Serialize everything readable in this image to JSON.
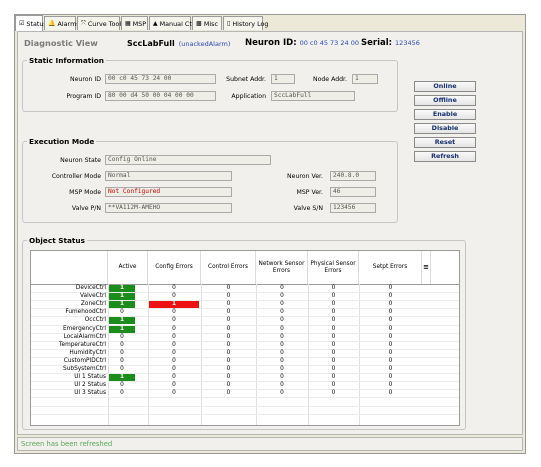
{
  "tabs": [
    {
      "label": "Status",
      "icon": "status-icon",
      "glyph": "☑"
    },
    {
      "label": "Alarms",
      "icon": "bell-icon",
      "glyph": "🔔"
    },
    {
      "label": "Curve Tool",
      "icon": "curve-tool-icon",
      "glyph": "⤧"
    },
    {
      "label": "MSP",
      "icon": "msp-icon",
      "glyph": "▦"
    },
    {
      "label": "Manual Ctrl",
      "icon": "manual-ctrl-icon",
      "glyph": "▲"
    },
    {
      "label": "Misc",
      "icon": "misc-icon",
      "glyph": "▩"
    },
    {
      "label": "History Log",
      "icon": "history-log-icon",
      "glyph": "▯"
    }
  ],
  "header": {
    "title": "Diagnostic View",
    "device": "SccLabFull",
    "alarm": "(unackedAlarm)",
    "neuron_id_label": "Neuron ID:",
    "neuron_id": "00 c0 45 73 24 00",
    "serial_label": "Serial:",
    "serial": "123456"
  },
  "static_info": {
    "title": "Static Information",
    "neuron_id_label": "Neuron ID",
    "neuron_id": "00 c0 45 73 24 00",
    "subnet_label": "Subnet Addr.",
    "subnet": "1",
    "node_label": "Node Addr.",
    "node": "1",
    "program_id_label": "Program ID",
    "program_id": "80 00 d4 50 00 04 00 00",
    "application_label": "Application",
    "application": "SccLabFull"
  },
  "buttons": [
    "Online",
    "Offline",
    "Enable",
    "Disable",
    "Reset",
    "Refresh"
  ],
  "execution": {
    "title": "Execution Mode",
    "neuron_state_label": "Neuron State",
    "neuron_state": "Config Online",
    "controller_mode_label": "Controller Mode",
    "controller_mode": "Normal",
    "msp_mode_label": "MSP Mode",
    "msp_mode": "Not Configured",
    "valve_pn_label": "Valve P/N",
    "valve_pn": "**VA112M-AMEHO",
    "neuron_ver_label": "Neuron Ver.",
    "neuron_ver": "240.8.0",
    "msp_ver_label": "MSP Ver.",
    "msp_ver": "46",
    "valve_sn_label": "Valve S/N",
    "valve_sn": "123456"
  },
  "object_status": {
    "title": "Object Status",
    "columns": [
      "Active",
      "Config Errors",
      "Control Errors",
      "Network Sensor Errors",
      "Physical Sensor Errors",
      "Setpt Errors"
    ],
    "rows": [
      {
        "name": "DeviceCtrl",
        "values": [
          "1",
          "0",
          "0",
          "0",
          "0",
          "0"
        ]
      },
      {
        "name": "ValveCtrl",
        "values": [
          "1",
          "0",
          "0",
          "0",
          "0",
          "0"
        ]
      },
      {
        "name": "ZoneCtrl",
        "values": [
          "1",
          "1",
          "0",
          "0",
          "0",
          "0"
        ]
      },
      {
        "name": "FumehoodCtrl",
        "values": [
          "0",
          "0",
          "0",
          "0",
          "0",
          "0"
        ]
      },
      {
        "name": "OccCtrl",
        "values": [
          "1",
          "0",
          "0",
          "0",
          "0",
          "0"
        ]
      },
      {
        "name": "EmergencyCtrl",
        "values": [
          "1",
          "0",
          "0",
          "0",
          "0",
          "0"
        ]
      },
      {
        "name": "LocalAlarmCtrl",
        "values": [
          "0",
          "0",
          "0",
          "0",
          "0",
          "0"
        ]
      },
      {
        "name": "TemperatureCtrl",
        "values": [
          "0",
          "0",
          "0",
          "0",
          "0",
          "0"
        ]
      },
      {
        "name": "HumidityCtrl",
        "values": [
          "0",
          "0",
          "0",
          "0",
          "0",
          "0"
        ]
      },
      {
        "name": "CustomPIDCtrl",
        "values": [
          "0",
          "0",
          "0",
          "0",
          "0",
          "0"
        ]
      },
      {
        "name": "SubSystemCtrl",
        "values": [
          "0",
          "0",
          "0",
          "0",
          "0",
          "0"
        ]
      },
      {
        "name": "UI 1 Status",
        "values": [
          "1",
          "0",
          "0",
          "0",
          "0",
          "0"
        ]
      },
      {
        "name": "UI 2 Status",
        "values": [
          "0",
          "0",
          "0",
          "0",
          "0",
          "0"
        ]
      },
      {
        "name": "UI 3 Status",
        "values": [
          "0",
          "0",
          "0",
          "0",
          "0",
          "0"
        ]
      }
    ],
    "highlight": [
      {
        "row": 0,
        "col": 0,
        "color": "green"
      },
      {
        "row": 1,
        "col": 0,
        "color": "green"
      },
      {
        "row": 2,
        "col": 0,
        "color": "green"
      },
      {
        "row": 2,
        "col": 1,
        "color": "red"
      },
      {
        "row": 4,
        "col": 0,
        "color": "green"
      },
      {
        "row": 5,
        "col": 0,
        "color": "green"
      },
      {
        "row": 11,
        "col": 0,
        "color": "green"
      }
    ]
  },
  "status_bar": "Screen has been refreshed",
  "colors": {
    "active_green": "#1c8c1c",
    "error_red": "#ee1111",
    "link_blue": "#2a48b8",
    "status_green": "#58a458"
  }
}
